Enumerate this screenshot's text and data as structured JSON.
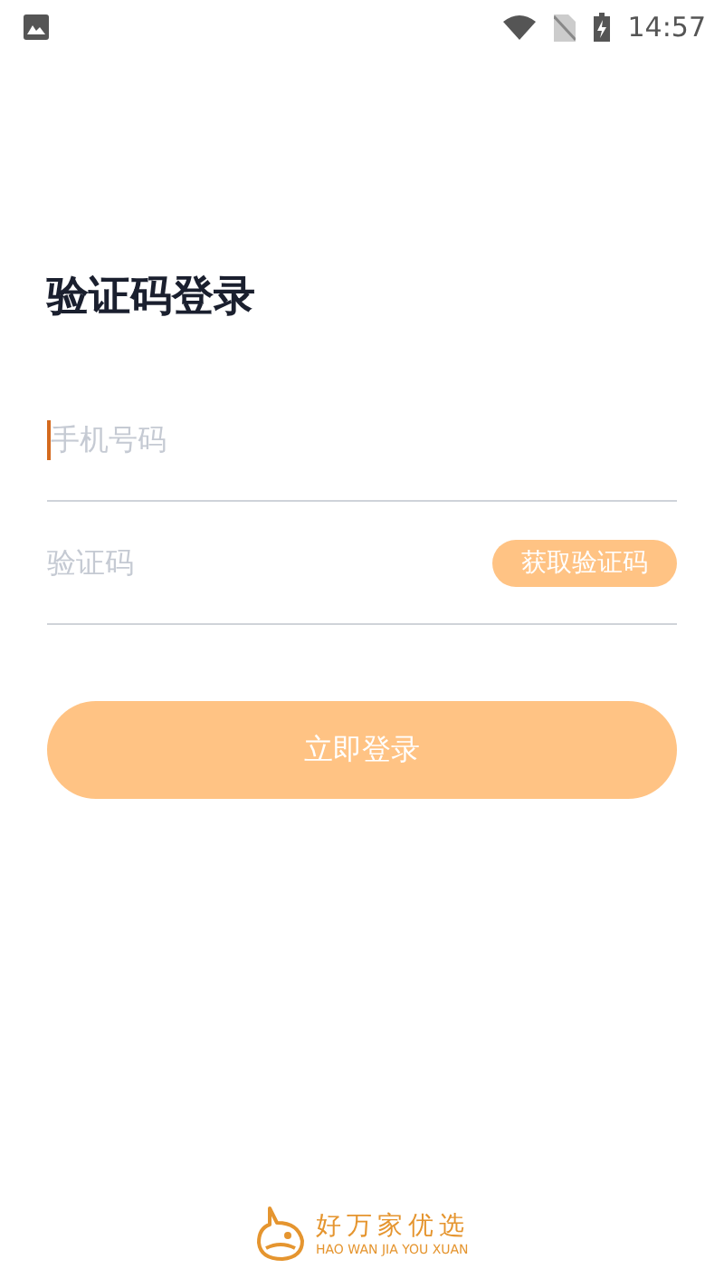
{
  "status_bar": {
    "time": "14:57"
  },
  "title": "验证码登录",
  "fields": [
    {
      "placeholder": "手机号码",
      "focused": true
    },
    {
      "placeholder": "验证码",
      "focused": false,
      "action": "获取验证码"
    }
  ],
  "login_button": "立即登录",
  "brand": {
    "name": "好万家优选",
    "pinyin": "HAO WAN JIA YOU XUAN"
  }
}
